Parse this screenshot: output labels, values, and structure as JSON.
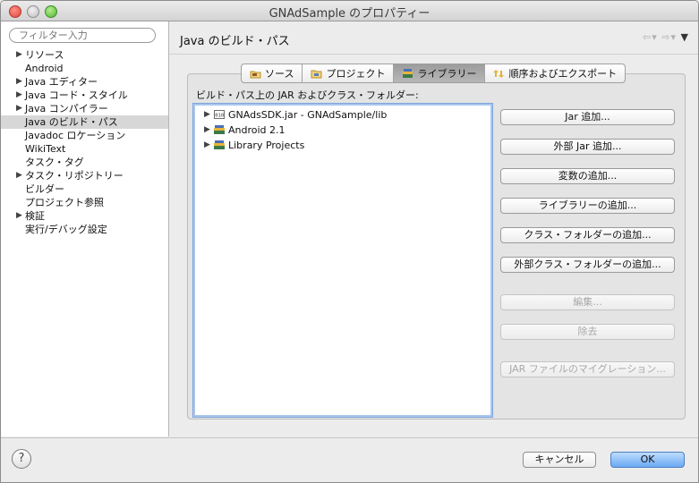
{
  "window": {
    "title": "GNAdSample のプロパティー"
  },
  "sidebar": {
    "filter_placeholder": "フィルター入力",
    "items": [
      {
        "label": "リソース",
        "expandable": true
      },
      {
        "label": "Android",
        "expandable": false
      },
      {
        "label": "Java エディター",
        "expandable": true
      },
      {
        "label": "Java コード・スタイル",
        "expandable": true
      },
      {
        "label": "Java コンパイラー",
        "expandable": true
      },
      {
        "label": "Java のビルド・パス",
        "expandable": false,
        "selected": true
      },
      {
        "label": "Javadoc ロケーション",
        "expandable": false
      },
      {
        "label": "WikiText",
        "expandable": false
      },
      {
        "label": "タスク・タグ",
        "expandable": false
      },
      {
        "label": "タスク・リポジトリー",
        "expandable": true
      },
      {
        "label": "ビルダー",
        "expandable": false
      },
      {
        "label": "プロジェクト参照",
        "expandable": false
      },
      {
        "label": "検証",
        "expandable": true
      },
      {
        "label": "実行/デバッグ設定",
        "expandable": false
      }
    ]
  },
  "main": {
    "title": "Java のビルド・パス",
    "tabs": [
      {
        "label": "ソース",
        "icon": "source-icon"
      },
      {
        "label": "プロジェクト",
        "icon": "project-folder-icon"
      },
      {
        "label": "ライブラリー",
        "icon": "library-icon",
        "active": true
      },
      {
        "label": "順序およびエクスポート",
        "icon": "order-export-icon"
      }
    ],
    "list_label": "ビルド・パス上の JAR およびクラス・フォルダー:",
    "entries": [
      {
        "label": "GNAdsSDK.jar - GNAdSample/lib",
        "icon": "jar-icon"
      },
      {
        "label": "Android 2.1",
        "icon": "library-icon"
      },
      {
        "label": "Library Projects",
        "icon": "library-icon"
      }
    ],
    "buttons": [
      {
        "label": "Jar 追加...",
        "enabled": true
      },
      {
        "label": "外部 Jar 追加...",
        "enabled": true
      },
      {
        "label": "変数の追加...",
        "enabled": true
      },
      {
        "label": "ライブラリーの追加...",
        "enabled": true
      },
      {
        "label": "クラス・フォルダーの追加...",
        "enabled": true
      },
      {
        "label": "外部クラス・フォルダーの追加...",
        "enabled": true
      },
      {
        "label": "編集...",
        "enabled": false
      },
      {
        "label": "除去",
        "enabled": false
      },
      {
        "label": "JAR ファイルのマイグレーション...",
        "enabled": false
      }
    ]
  },
  "footer": {
    "help_symbol": "?",
    "cancel_label": "キャンセル",
    "ok_label": "OK"
  },
  "colors": {
    "selection_gray": "#d7d7d7",
    "list_focus": "#7fa5dd",
    "ok_blue": "#6aa9f2",
    "close_red": "#e0443a"
  }
}
